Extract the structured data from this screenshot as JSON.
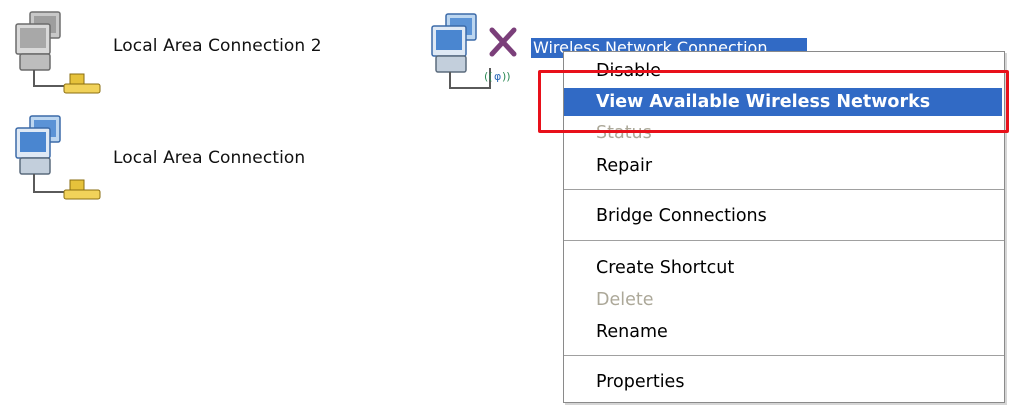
{
  "connections": [
    {
      "name": "Local Area Connection 2",
      "icon": "lan-connection-icon"
    },
    {
      "name": "Local Area Connection",
      "icon": "lan-connection-icon"
    },
    {
      "name": "Wireless Network Connection",
      "icon": "wireless-connection-disabled-icon"
    }
  ],
  "context_menu": {
    "items": [
      {
        "label": "Disable",
        "state": "normal"
      },
      {
        "label": "View Available Wireless Networks",
        "state": "highlighted"
      },
      {
        "label": "Status",
        "state": "disabled"
      },
      {
        "label": "Repair",
        "state": "normal"
      },
      {
        "label": "Bridge Connections",
        "state": "normal"
      },
      {
        "label": "Create Shortcut",
        "state": "normal"
      },
      {
        "label": "Delete",
        "state": "disabled"
      },
      {
        "label": "Rename",
        "state": "normal"
      },
      {
        "label": "Properties",
        "state": "normal"
      }
    ]
  },
  "colors": {
    "highlight": "#316ac5",
    "annotation": "#e8101a",
    "disabled_text": "#aca899"
  }
}
